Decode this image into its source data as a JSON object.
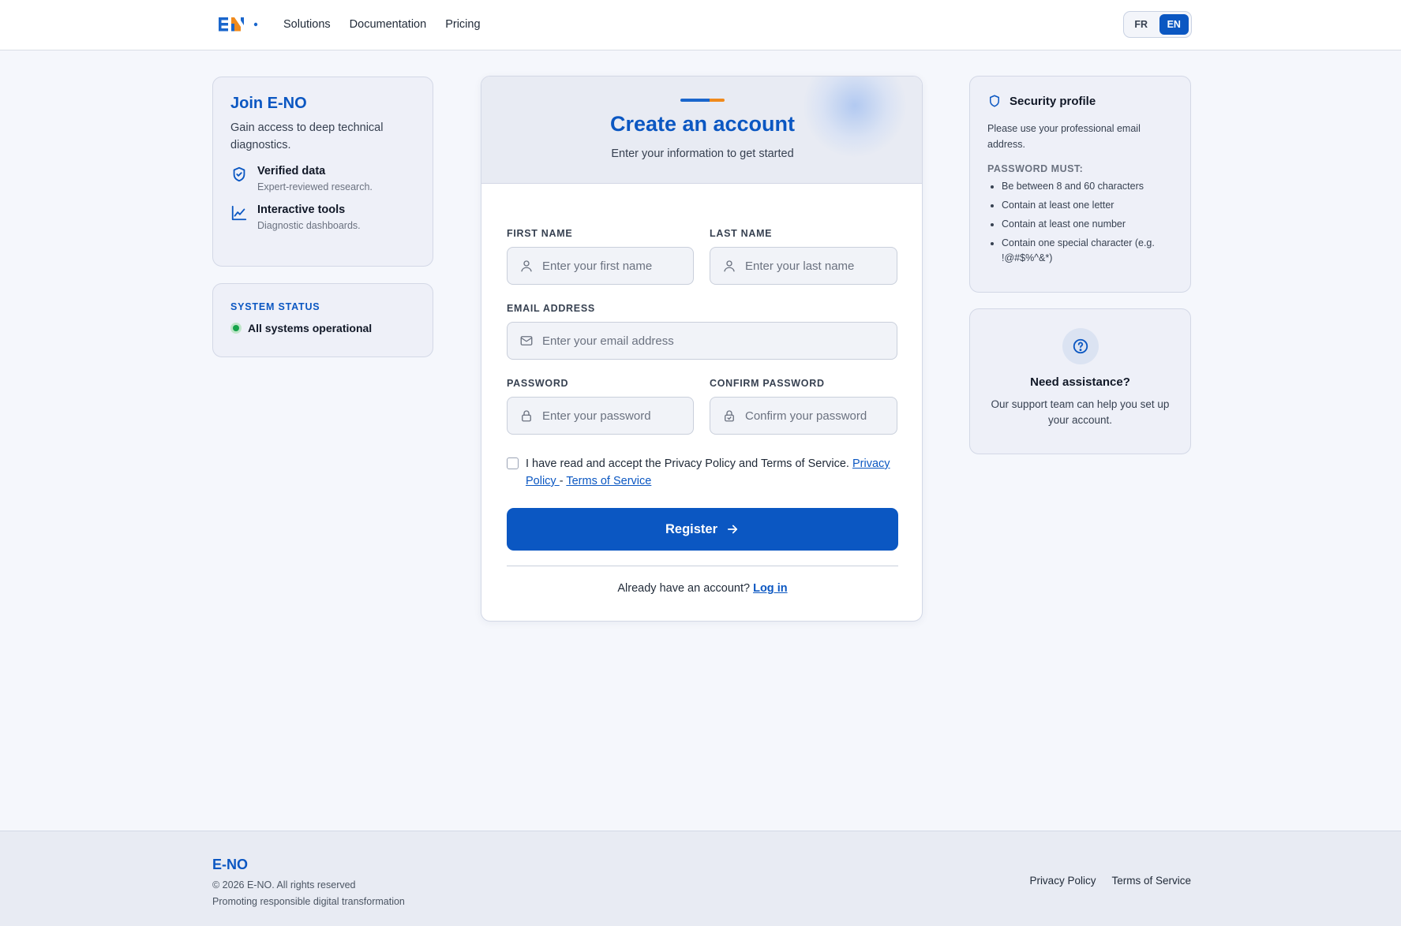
{
  "header": {
    "nav": [
      "Solutions",
      "Documentation",
      "Pricing"
    ],
    "languages": [
      "FR",
      "EN"
    ],
    "active_language": "EN"
  },
  "join": {
    "title": "Join E-NO",
    "subtitle": "Gain access to deep technical diagnostics.",
    "features": [
      {
        "title": "Verified data",
        "desc": "Expert-reviewed research.",
        "icon": "shield-check-icon"
      },
      {
        "title": "Interactive tools",
        "desc": "Diagnostic dashboards.",
        "icon": "line-chart-icon"
      }
    ]
  },
  "status": {
    "label": "SYSTEM STATUS",
    "text": "All systems operational",
    "color": "#16a34a"
  },
  "form": {
    "title": "Create an account",
    "subtitle": "Enter your information to get started",
    "first_name": {
      "label": "FIRST NAME",
      "placeholder": "Enter your first name",
      "value": ""
    },
    "last_name": {
      "label": "LAST NAME",
      "placeholder": "Enter your last name",
      "value": ""
    },
    "email": {
      "label": "EMAIL ADDRESS",
      "placeholder": "Enter your email address",
      "value": ""
    },
    "password": {
      "label": "PASSWORD",
      "placeholder": "Enter your password",
      "value": ""
    },
    "confirm": {
      "label": "CONFIRM PASSWORD",
      "placeholder": "Confirm your password",
      "value": ""
    },
    "terms_text": "I have read and accept the Privacy Policy and Terms of Service. ",
    "privacy_link": "Privacy Policy ",
    "separator": "-",
    "terms_link": "Terms of Service",
    "register_label": "Register",
    "login_prompt": "Already have an account? ",
    "login_link": "Log in"
  },
  "security": {
    "title": "Security profile",
    "text": "Please use your professional email address.",
    "pw_label": "PASSWORD MUST:",
    "rules": [
      "Be between 8 and 60 characters",
      "Contain at least one letter",
      "Contain at least one number",
      "Contain one special character (e.g. !@#$%^&*)"
    ]
  },
  "help": {
    "title": "Need assistance?",
    "text": "Our support team can help you set up your account."
  },
  "footer": {
    "brand": "E-NO",
    "copyright": "© 2026 E-NO. All rights reserved",
    "tagline": "Promoting responsible digital transformation",
    "links": [
      "Privacy Policy",
      "Terms of Service"
    ]
  },
  "colors": {
    "accent": "#0b57c2",
    "accent_orange": "#f08a1c",
    "background": "#f5f7fc"
  }
}
